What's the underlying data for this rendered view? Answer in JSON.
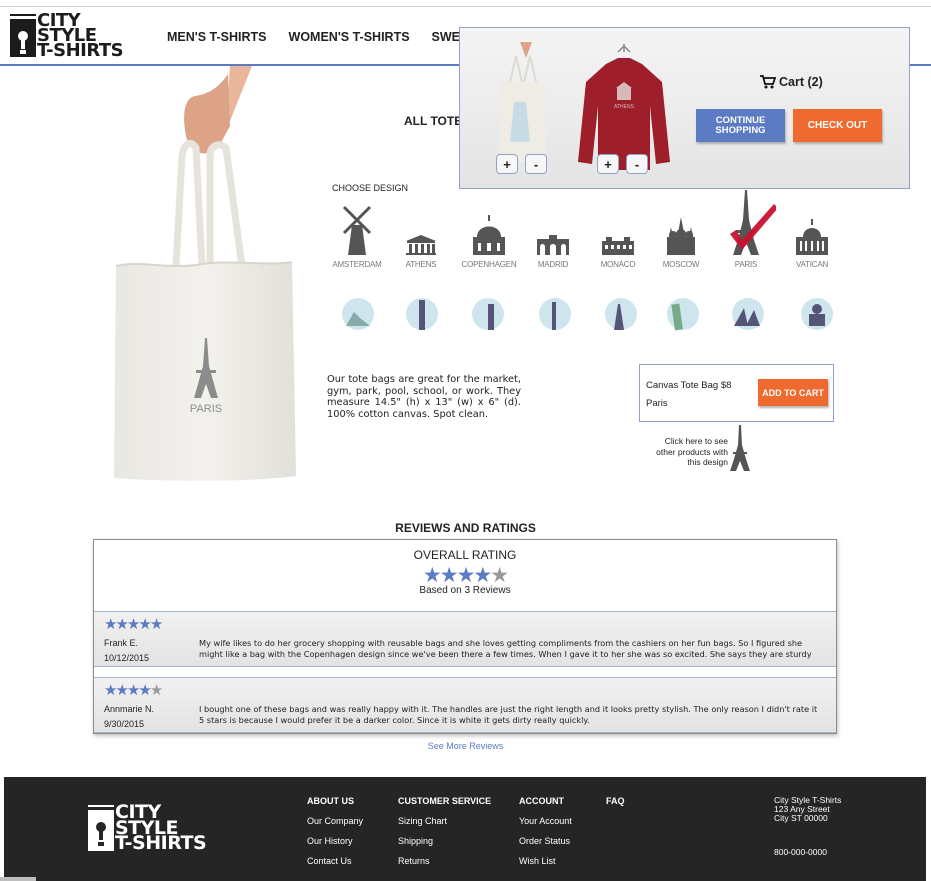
{
  "brand": {
    "line1": "CITY",
    "line2": "STYLE",
    "line3": "T-SHIRTS"
  },
  "nav": {
    "items": [
      "MEN'S T-SHIRTS",
      "WOMEN'S T-SHIRTS",
      "SWEATSHI"
    ]
  },
  "cart": {
    "title": "Cart (2)",
    "continue_label_1": "CONTINUE",
    "continue_label_2": "SHOPPING",
    "checkout_label": "CHECK OUT",
    "plus": "+",
    "minus": "-",
    "sweater_print": "ATHENS"
  },
  "product": {
    "headline": "ALL TOTE",
    "choose_label": "CHOOSE DESIGN",
    "bag_print": "PARIS",
    "designs": [
      "AMSTERDAM",
      "ATHENS",
      "COPENHAGEN",
      "MADRID",
      "MONACO",
      "MOSCOW",
      "PARIS",
      "VATICAN"
    ],
    "selected_design": "PARIS",
    "description": "Our tote bags are great for the market, gym, park, pool, school, or work. They measure 14.5\" (h) x 13\" (w) x 6\" (d). 100% cotton canvas. Spot clean.",
    "box_title": "Canvas Tote Bag $8",
    "box_design": "Paris",
    "add_to_cart": "ADD TO CART",
    "click_here": "Click here to see other products with this design"
  },
  "reviews": {
    "heading": "REVIEWS AND RATINGS",
    "overall_label": "OVERALL RATING",
    "overall_stars": 4,
    "based_on": "Based on 3 Reviews",
    "items": [
      {
        "stars": 5,
        "name": "Frank E.",
        "date": "10/12/2015",
        "text": "My wife likes to do her grocery shopping with reusable bags and she loves getting compliments from the cashiers on her fun bags. So I figured she might like a bag with the Copenhagen design since we've been there a few times. When I gave it to her she was so excited. She says they are sturdy and the h…"
      },
      {
        "stars": 4,
        "name": "Annmarie N.",
        "date": "9/30/2015",
        "text": "I bought one of these bags and was really happy with it. The handles are just the right length and it looks pretty stylish. The only reason I didn't rate it 5 stars is because I would prefer it be a darker color. Since it is white it gets dirty really quickly."
      }
    ],
    "see_more": "See More Reviews"
  },
  "footer": {
    "about": {
      "heading": "ABOUT US",
      "links": [
        "Our Company",
        "Our History",
        "Contact Us"
      ]
    },
    "service": {
      "heading": "CUSTOMER SERVICE",
      "links": [
        "Sizing Chart",
        "Shipping",
        "Returns"
      ]
    },
    "account": {
      "heading": "ACCOUNT",
      "links": [
        "Your Account",
        "Order Status",
        "Wish List"
      ]
    },
    "faq": {
      "heading": "FAQ"
    },
    "address": [
      "City Style T-Shirts",
      "123 Any Street",
      "City ST 00000"
    ],
    "phone": "800-000-0000"
  },
  "colors": {
    "accent_blue": "#5b7bc2",
    "accent_orange": "#ef6a2e",
    "footer_bg": "#252525",
    "check_red": "#c8102e"
  }
}
